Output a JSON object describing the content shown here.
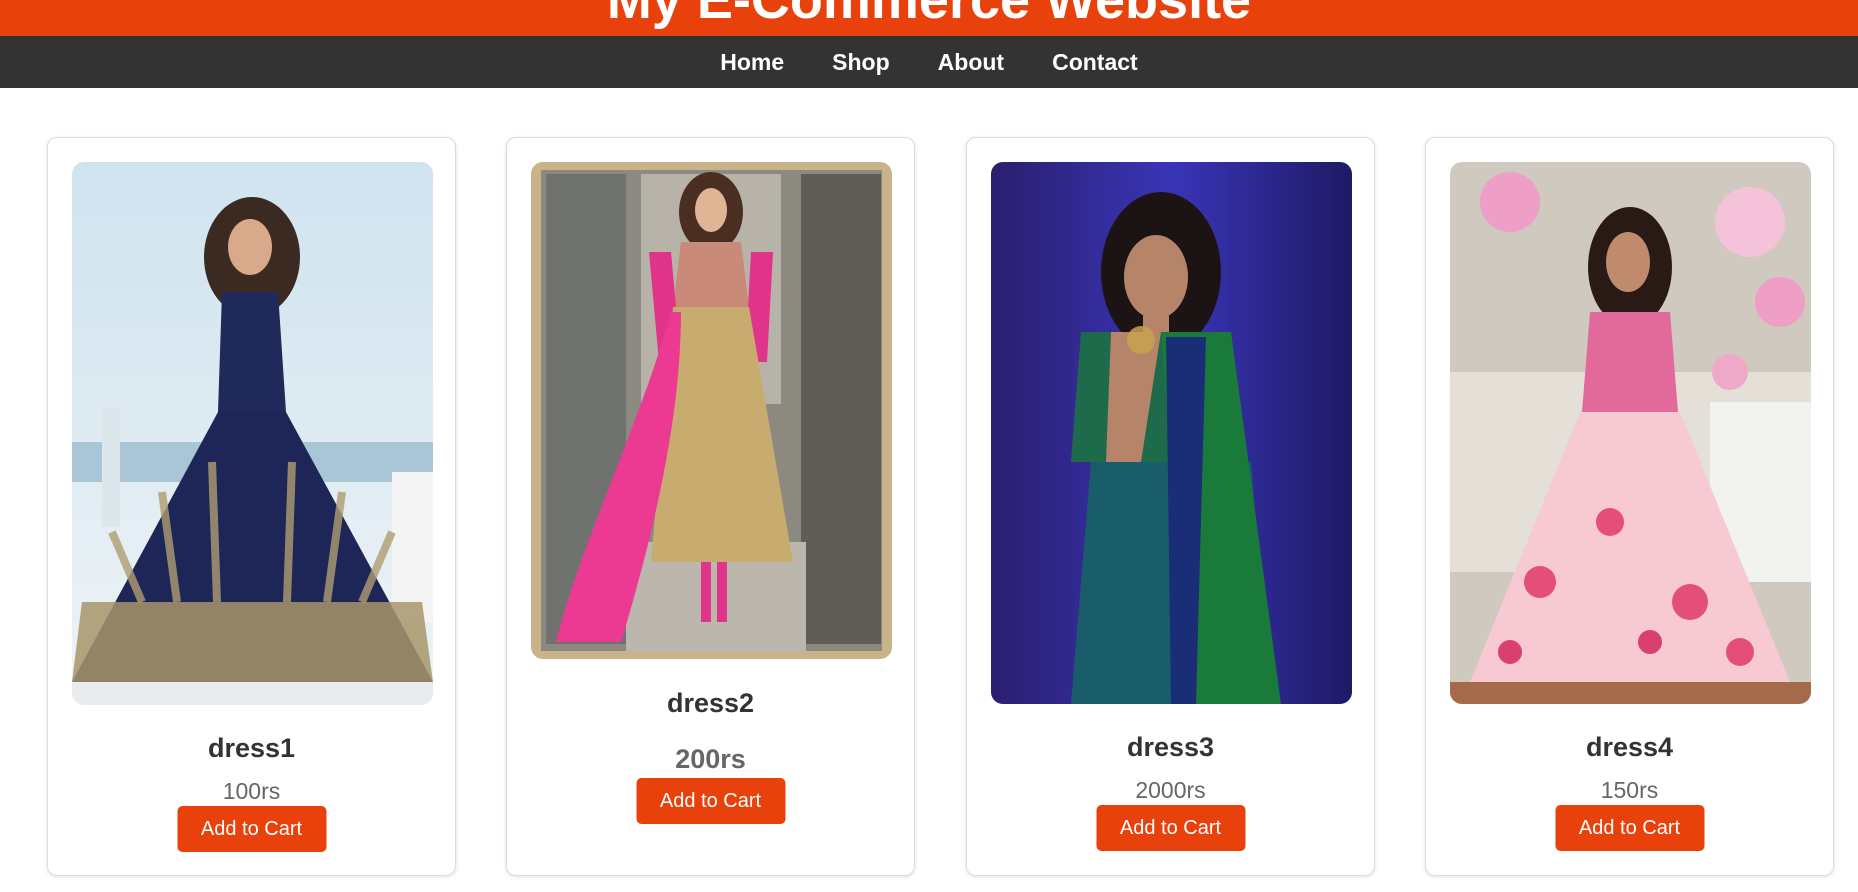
{
  "header": {
    "title": "My E-Commerce Website"
  },
  "nav": {
    "items": [
      "Home",
      "Shop",
      "About",
      "Contact"
    ]
  },
  "products": [
    {
      "name": "dress1",
      "price": "100rs",
      "button": "Add to Cart"
    },
    {
      "name": "dress2",
      "price": "200rs",
      "button": "Add to Cart"
    },
    {
      "name": "dress3",
      "price": "2000rs",
      "button": "Add to Cart"
    },
    {
      "name": "dress4",
      "price": "150rs",
      "button": "Add to Cart"
    }
  ],
  "colors": {
    "accent": "#e8410c",
    "navbar": "#333333"
  }
}
